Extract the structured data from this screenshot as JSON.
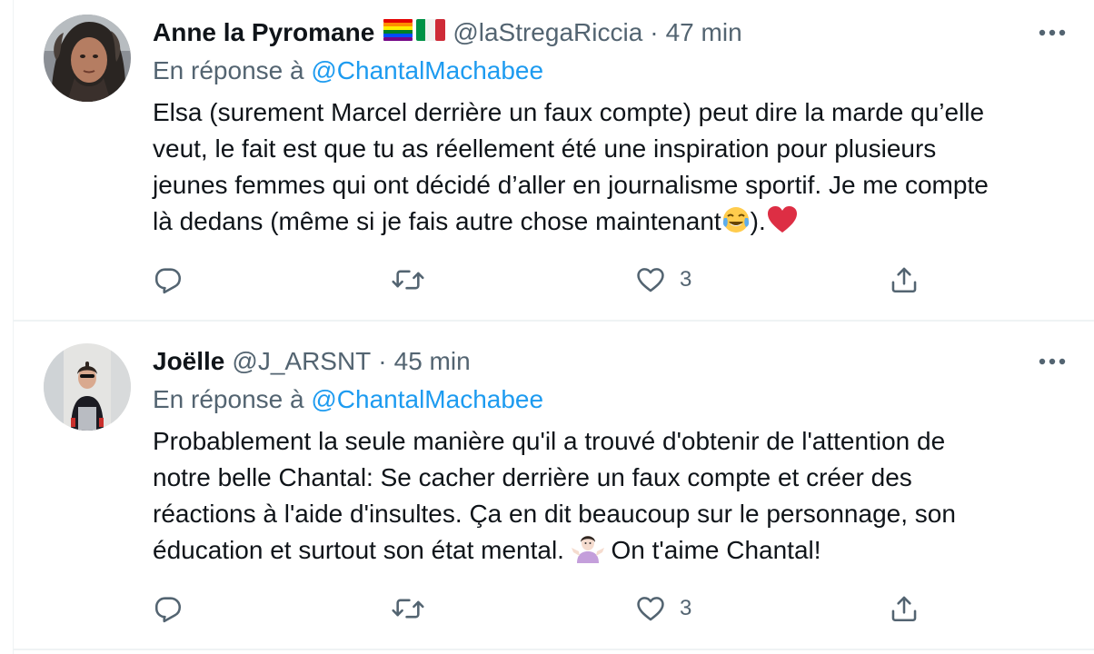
{
  "tweets": [
    {
      "display_name": "Anne la Pyromane",
      "flag_icons": [
        "rainbow-flag-icon",
        "italy-flag-icon"
      ],
      "handle": "@laStregaRiccia",
      "separator": "·",
      "time": "47 min",
      "reply_prefix": "En réponse à",
      "reply_mention": "@ChantalMachabee",
      "body_lines": [
        "Elsa (surement Marcel derrière un faux compte) peut dire la marde qu’elle",
        "veut, le fait est que tu as réellement été une inspiration pour plusieurs",
        "jeunes femmes qui ont décidé d’aller en journalisme sportif. Je me compte",
        "là dedans (même si je fais autre chose maintenant",
        ")."
      ],
      "body_emojis": [
        "face-with-tears-of-joy-emoji",
        "red-heart-emoji"
      ],
      "like_count": "3"
    },
    {
      "display_name": "Joëlle",
      "handle": "@J_ARSNT",
      "separator": "·",
      "time": "45 min",
      "reply_prefix": "En réponse à",
      "reply_mention": "@ChantalMachabee",
      "body_lines": [
        "Probablement la seule manière qu'il a trouvé d'obtenir de l'attention de",
        "notre belle Chantal: Se cacher derrière un faux compte et créer des",
        "réactions à l'aide d'insultes. Ça en dit beaucoup sur le personnage, son",
        "éducation et surtout son état mental.",
        "On t'aime Chantal!"
      ],
      "body_emojis": [
        "person-shrugging-emoji"
      ],
      "like_count": "3"
    }
  ],
  "colors": {
    "text_primary": "#0f1419",
    "text_secondary": "#536471",
    "link": "#1d9bf0",
    "like_heart_emoji": "#e0245e",
    "divider": "#eff3f4"
  }
}
